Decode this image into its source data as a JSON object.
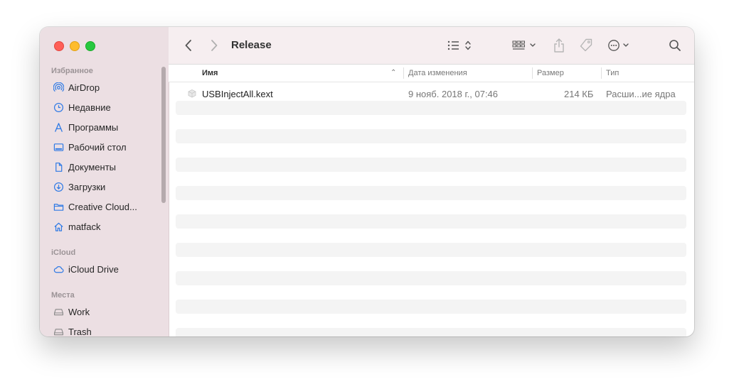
{
  "window": {
    "title": "Release"
  },
  "sidebar": {
    "sections": [
      {
        "label": "Избранное"
      },
      {
        "label": "iCloud"
      },
      {
        "label": "Места"
      }
    ],
    "favorites": [
      {
        "label": "AirDrop",
        "icon": "airdrop-icon"
      },
      {
        "label": "Недавние",
        "icon": "clock-icon"
      },
      {
        "label": "Программы",
        "icon": "apps-icon"
      },
      {
        "label": "Рабочий стол",
        "icon": "desktop-icon"
      },
      {
        "label": "Документы",
        "icon": "document-icon"
      },
      {
        "label": "Загрузки",
        "icon": "download-icon"
      },
      {
        "label": "Creative Cloud...",
        "icon": "folder-icon"
      },
      {
        "label": "matfack",
        "icon": "home-icon"
      }
    ],
    "icloud": [
      {
        "label": "iCloud Drive",
        "icon": "cloud-icon"
      }
    ],
    "locations": [
      {
        "label": "Work",
        "icon": "disk-icon"
      },
      {
        "label": "Trash",
        "icon": "disk-icon"
      }
    ]
  },
  "columns": {
    "name": "Имя",
    "date": "Дата изменения",
    "size": "Размер",
    "kind": "Тип"
  },
  "files": [
    {
      "name": "USBInjectAll.kext",
      "date": "9 нояб. 2018 г., 07:46",
      "size": "214 КБ",
      "kind": "Расши...ие ядра"
    }
  ],
  "colors": {
    "sidebar": "#ecdfe3",
    "toolbar": "#f6eef0",
    "accent": "#0a84ff"
  }
}
